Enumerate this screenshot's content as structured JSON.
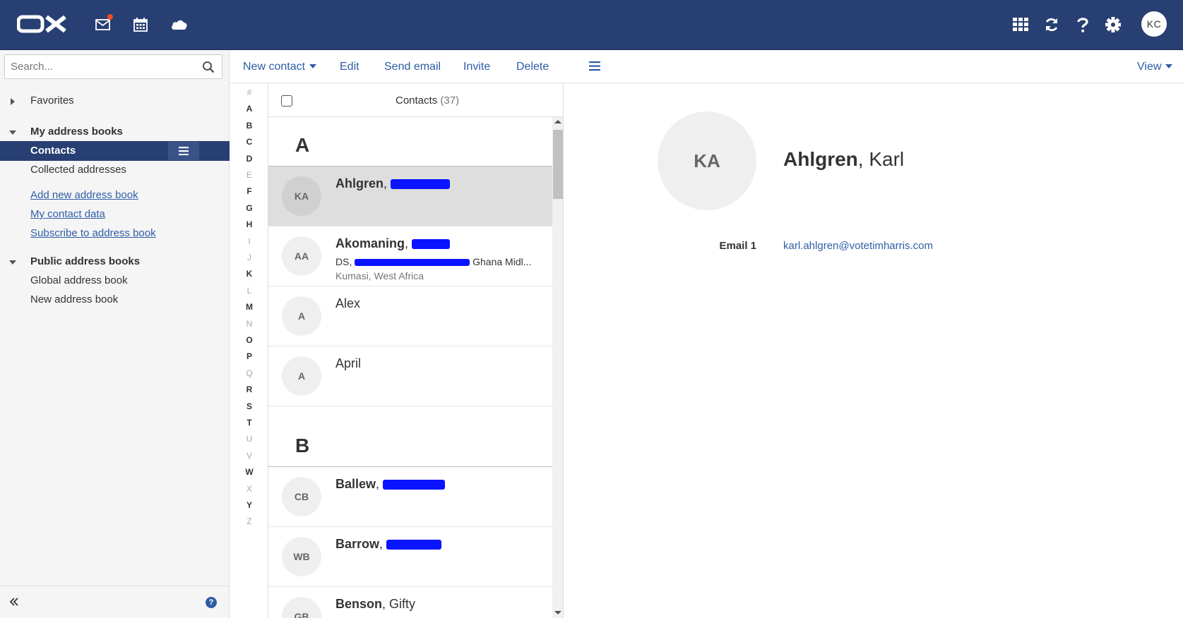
{
  "topbar": {
    "logo": "OX",
    "apps": [
      {
        "name": "mail-icon",
        "notification": true
      },
      {
        "name": "calendar-icon"
      },
      {
        "name": "cloud-drive-icon"
      }
    ],
    "tools": [
      "apps-grid-icon",
      "refresh-icon",
      "help-icon",
      "settings-icon"
    ],
    "user_initials": "KC",
    "bg_color": "#283f73"
  },
  "sidebar": {
    "search_placeholder": "Search...",
    "favorites": "Favorites",
    "my_address_books": "My address books",
    "contacts": "Contacts",
    "collected_addresses": "Collected addresses",
    "links": [
      "Add new address book",
      "My contact data",
      "Subscribe to address book"
    ],
    "public_address_books": "Public address books",
    "global_address_book": "Global address book",
    "new_address_book": "New address book"
  },
  "toolbar": {
    "new_contact": "New contact",
    "edit": "Edit",
    "send_email": "Send email",
    "invite": "Invite",
    "delete": "Delete",
    "view": "View"
  },
  "alphabet": [
    {
      "l": "#",
      "on": false
    },
    {
      "l": "A",
      "on": true
    },
    {
      "l": "B",
      "on": true
    },
    {
      "l": "C",
      "on": true
    },
    {
      "l": "D",
      "on": true
    },
    {
      "l": "E",
      "on": false
    },
    {
      "l": "F",
      "on": true
    },
    {
      "l": "G",
      "on": true
    },
    {
      "l": "H",
      "on": true
    },
    {
      "l": "I",
      "on": false
    },
    {
      "l": "J",
      "on": false
    },
    {
      "l": "K",
      "on": true
    },
    {
      "l": "L",
      "on": false
    },
    {
      "l": "M",
      "on": true
    },
    {
      "l": "N",
      "on": false
    },
    {
      "l": "O",
      "on": true
    },
    {
      "l": "P",
      "on": true
    },
    {
      "l": "Q",
      "on": false
    },
    {
      "l": "R",
      "on": true
    },
    {
      "l": "S",
      "on": true
    },
    {
      "l": "T",
      "on": true
    },
    {
      "l": "U",
      "on": false
    },
    {
      "l": "V",
      "on": false
    },
    {
      "l": "W",
      "on": true
    },
    {
      "l": "X",
      "on": false
    },
    {
      "l": "Y",
      "on": true
    },
    {
      "l": "Z",
      "on": false
    }
  ],
  "list": {
    "title": "Contacts",
    "count": "(37)",
    "section_a": "A",
    "section_b": "B",
    "rows": [
      {
        "initials": "KA",
        "last": "Ahlgren",
        "first": "",
        "line2": "",
        "line3": ""
      },
      {
        "initials": "AA",
        "last": "Akomaning",
        "first": "",
        "line2_prefix": "DS,",
        "line2_suffix": "Ghana Midl...",
        "line3": "Kumasi, West Africa"
      },
      {
        "initials": "A",
        "last": "",
        "first": "Alex",
        "line2": "",
        "line3": ""
      },
      {
        "initials": "A",
        "last": "",
        "first": "April",
        "line2": "",
        "line3": ""
      },
      {
        "initials": "CB",
        "last": "Ballew",
        "first": "",
        "line2": "",
        "line3": ""
      },
      {
        "initials": "WB",
        "last": "Barrow",
        "first": "",
        "line2": "",
        "line3": ""
      },
      {
        "initials": "GB",
        "last": "Benson",
        "first": "Gifty",
        "line2": "",
        "line3": ""
      }
    ]
  },
  "detail": {
    "initials": "KA",
    "last_name": "Ahlgren",
    "first_name": "Karl",
    "email_label": "Email 1",
    "email": "karl.ahlgren@votetimharris.com"
  }
}
